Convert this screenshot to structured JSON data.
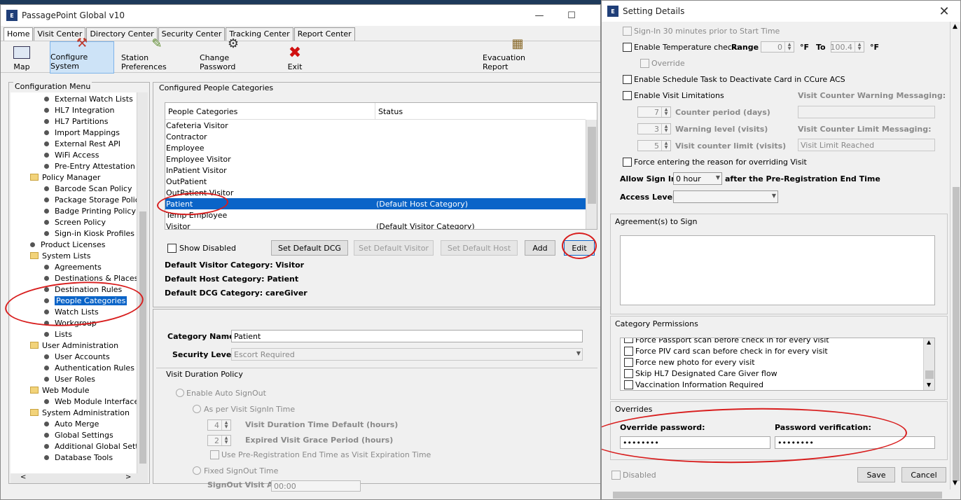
{
  "main_window": {
    "title": "PassagePoint Global v10",
    "icon_text": "E",
    "tabs": [
      "Home",
      "Visit Center",
      "Directory Center",
      "Security Center",
      "Tracking Center",
      "Report Center"
    ],
    "toolbar": {
      "map": "Map",
      "configure_system": "Configure System",
      "station_preferences": "Station Preferences",
      "change_password": "Change Password",
      "exit": "Exit",
      "evacuation_report": "Evacuation Report"
    }
  },
  "config_menu": {
    "title": "Configuration Menu",
    "items": [
      "External Watch Lists",
      "HL7 Integration",
      "HL7 Partitions",
      "Import Mappings",
      "External Rest API",
      "WiFi Access",
      "Pre-Entry Attestation",
      "Policy Manager",
      "Barcode Scan Policy",
      "Package Storage Policy",
      "Badge Printing Policy",
      "Screen Policy",
      "Sign-in Kiosk Profiles",
      "Product Licenses",
      "System Lists",
      "Agreements",
      "Destinations & Places",
      "Destination Rules",
      "People Categories",
      "Watch Lists",
      "Workgroup",
      "Lists",
      "User Administration",
      "User Accounts",
      "Authentication Rules",
      "User Roles",
      "Web Module",
      "Web Module Interfaces",
      "System Administration",
      "Auto Merge",
      "Global Settings",
      "Additional Global Setting",
      "Database Tools"
    ]
  },
  "people_categories": {
    "group_title": "Configured People Categories",
    "col_category": "People Categories",
    "col_status": "Status",
    "rows": [
      {
        "name": "Cafeteria Visitor",
        "status": ""
      },
      {
        "name": "Contractor",
        "status": ""
      },
      {
        "name": "Employee",
        "status": ""
      },
      {
        "name": "Employee Visitor",
        "status": ""
      },
      {
        "name": "InPatient Visitor",
        "status": ""
      },
      {
        "name": "OutPatient",
        "status": ""
      },
      {
        "name": "OutPatient Visitor",
        "status": ""
      },
      {
        "name": "Patient",
        "status": "(Default Host Category)"
      },
      {
        "name": "Temp Employee",
        "status": ""
      },
      {
        "name": "Visitor",
        "status": "(Default Visitor Category)"
      }
    ],
    "show_disabled": "Show Disabled",
    "btn_set_default_dcg": "Set Default DCG",
    "btn_set_default_visitor": "Set Default Visitor",
    "btn_set_default_host": "Set Default Host",
    "btn_add": "Add",
    "btn_edit": "Edit",
    "default_visitor": "Default Visitor Category: Visitor",
    "default_host": "Default Host Category: Patient",
    "default_dcg": "Default DCG Category: careGiver"
  },
  "category_detail": {
    "name_label": "Category Name",
    "name_value": "Patient",
    "security_label": "Security Level",
    "security_value": "Escort Required",
    "vdp_title": "Visit Duration Policy",
    "enable_auto_signout": "Enable Auto SignOut",
    "as_per_signin": "As per Visit SignIn Time",
    "duration_value": "4",
    "duration_label": "Visit Duration Time Default (hours)",
    "grace_value": "2",
    "grace_label": "Expired Visit Grace Period (hours)",
    "use_prereg": "Use Pre-Registration End Time as Visit Expiration Time",
    "fixed_signout": "Fixed SignOut Time",
    "signout_at_label": "SignOut Visit At:",
    "signout_at_value": "00:00"
  },
  "setting_details": {
    "title": "Setting Details",
    "icon_text": "E",
    "signin_30": "Sign-In 30 minutes prior to Start Time",
    "enable_temp": "Enable Temperature check:",
    "range_label": "Range",
    "range_from": "0",
    "unit_f1": "°F",
    "to_label": "To",
    "range_to": "100.4",
    "unit_f2": "°F",
    "override": "Override",
    "schedule_task": "Enable Schedule Task to Deactivate Card in CCure ACS",
    "visit_limitations": "Enable Visit Limitations",
    "counter_period_value": "7",
    "counter_period_label": "Counter period (days)",
    "warning_level_value": "3",
    "warning_level_label": "Warning level (visits)",
    "visit_counter_limit_value": "5",
    "visit_counter_limit_label": "Visit counter limit (visits)",
    "warning_msg_label": "Visit Counter Warning Messaging:",
    "warning_msg_value": "",
    "limit_msg_label": "Visit Counter Limit Messaging:",
    "limit_msg_value": "Visit Limit Reached",
    "force_reason": "Force entering the reason for overriding Visit",
    "allow_signin_label": "Allow Sign In",
    "allow_signin_value": "0 hour",
    "allow_signin_suffix": "after the Pre-Registration End Time",
    "access_level_label": "Access Level",
    "access_level_value": "",
    "agreements_title": "Agreement(s) to Sign",
    "permissions_title": "Category Permissions",
    "permissions": [
      "Force Passport scan before check in for every visit",
      "Force PIV card scan before check in for every visit",
      "Force new photo for every visit",
      "Skip HL7 Designated Care Giver flow",
      "Vaccination Information Required"
    ],
    "overrides_title": "Overrides",
    "override_password_label": "Override password:",
    "override_password_value": "••••••••",
    "password_verification_label": "Password verification:",
    "password_verification_value": "••••••••",
    "disabled": "Disabled",
    "save": "Save",
    "cancel": "Cancel"
  }
}
